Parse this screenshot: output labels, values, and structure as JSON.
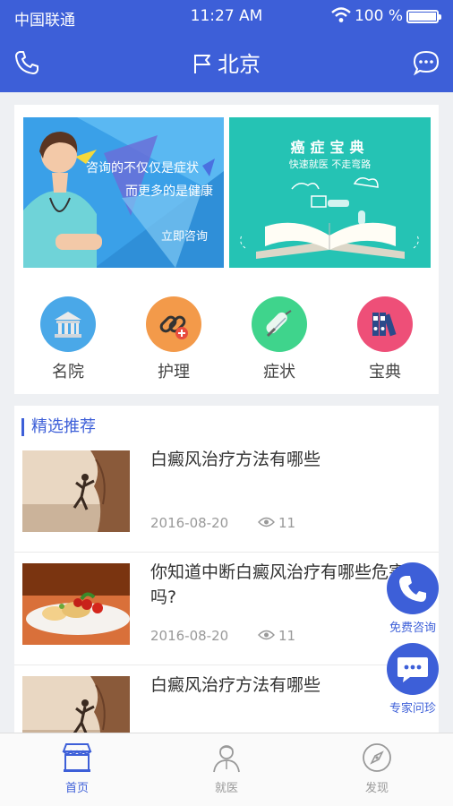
{
  "status_bar": {
    "carrier": "中国联通",
    "time": "11:27 AM",
    "battery_percent": "100 %"
  },
  "header": {
    "city": "北京",
    "left_icon": "phone-icon",
    "right_icon": "chat-bubble-icon"
  },
  "banners": {
    "left": {
      "line1": "咨询的不仅仅是症状",
      "line2": "而更多的是健康",
      "cta": "立即咨询"
    },
    "right": {
      "title": "癌症宝典",
      "subtitle": "快速就医 不走弯路"
    }
  },
  "categories": [
    {
      "label": "名院",
      "icon": "hospital-icon",
      "color": "#4aa8e8"
    },
    {
      "label": "护理",
      "icon": "bandage-link-icon",
      "color": "#f39a4a"
    },
    {
      "label": "症状",
      "icon": "pill-icon",
      "color": "#3fd48c"
    },
    {
      "label": "宝典",
      "icon": "binders-icon",
      "color": "#ee4f78"
    }
  ],
  "featured": {
    "title": "精选推荐",
    "articles": [
      {
        "title": "白癜风治疗方法有哪些",
        "date": "2016-08-20",
        "views": "11",
        "thumb": "climber-thumbnail"
      },
      {
        "title": "你知道中断白癜风治疗有哪些危害吗?",
        "date": "2016-08-20",
        "views": "11",
        "thumb": "food-thumbnail"
      },
      {
        "title": "白癜风治疗方法有哪些",
        "date": "",
        "views": "",
        "thumb": "climber-thumbnail"
      }
    ]
  },
  "floating": {
    "consult_label": "免费咨询",
    "expert_label": "专家问珍"
  },
  "tabbar": {
    "tabs": [
      {
        "label": "首页",
        "active": true
      },
      {
        "label": "就医",
        "active": false
      },
      {
        "label": "发现",
        "active": false
      }
    ]
  },
  "colors": {
    "brand": "#3d5fd8",
    "banner_left": "#3aa0e8",
    "banner_right": "#25c3b4"
  }
}
